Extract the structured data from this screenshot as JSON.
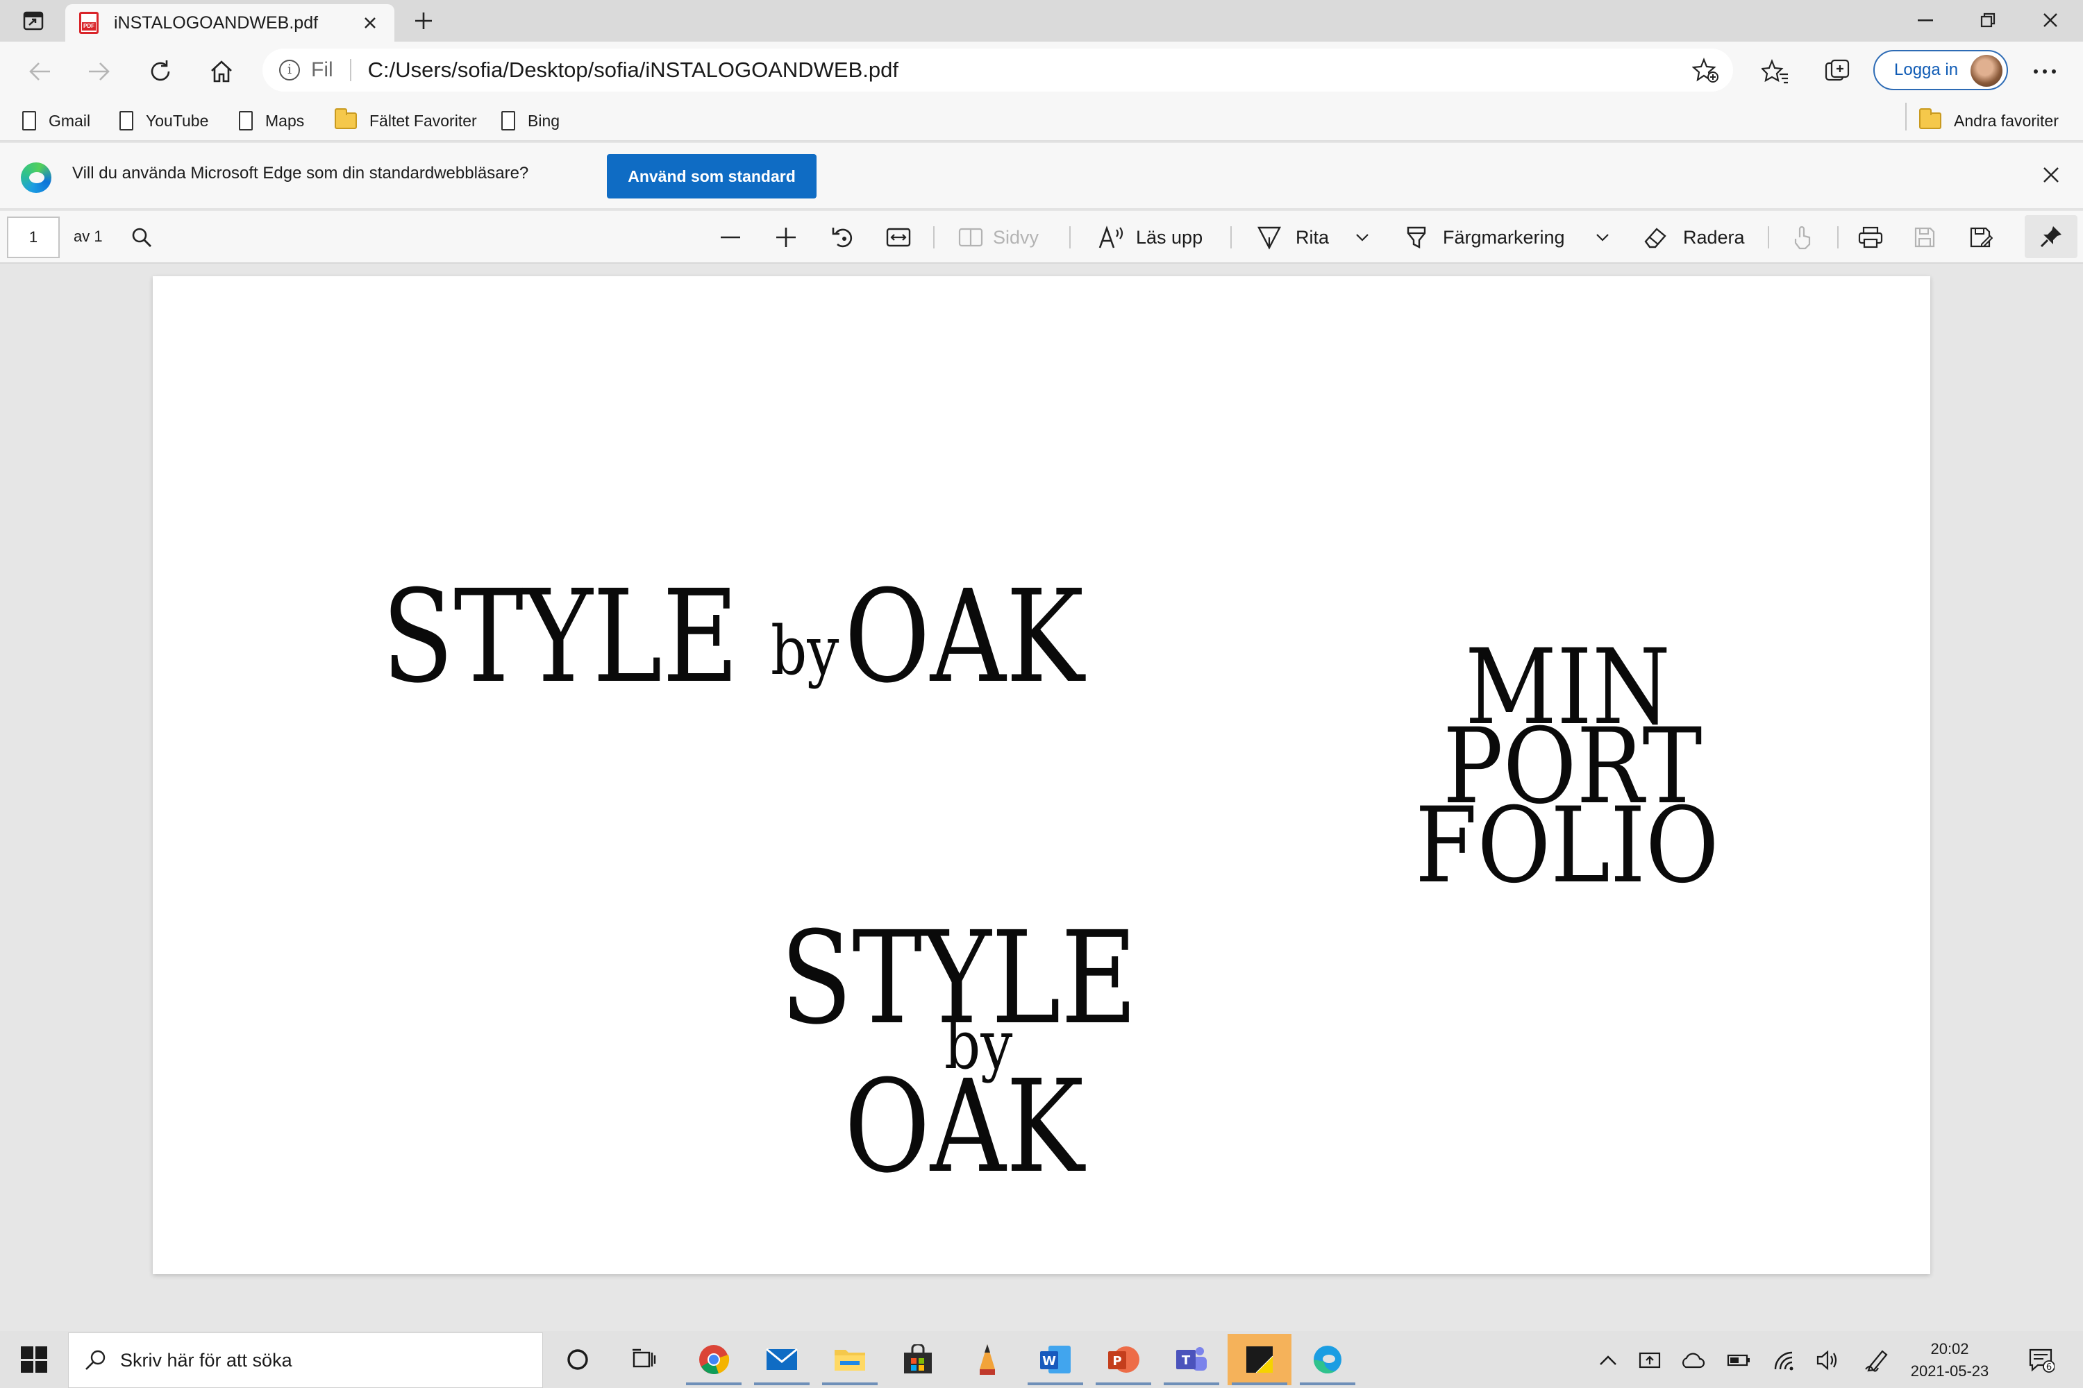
{
  "browser": {
    "tab": {
      "title": "iNSTALOGOANDWEB.pdf"
    },
    "address": {
      "protocol_label": "Fil",
      "url": "C:/Users/sofia/Desktop/sofia/iNSTALOGOANDWEB.pdf"
    },
    "login_label": "Logga in",
    "favorites": [
      {
        "label": "Gmail",
        "icon": "page-icon"
      },
      {
        "label": "YouTube",
        "icon": "page-icon"
      },
      {
        "label": "Maps",
        "icon": "page-icon"
      },
      {
        "label": "Fältet Favoriter",
        "icon": "folder-icon"
      },
      {
        "label": "Bing",
        "icon": "page-icon"
      }
    ],
    "other_favorites": "Andra favoriter",
    "infobar": {
      "message": "Vill du använda Microsoft Edge som din standardwebbläsare?",
      "button_label": "Använd som standard"
    }
  },
  "pdf_toolbar": {
    "page_number": "1",
    "page_total": "av 1",
    "page_view": "Sidvy",
    "read_aloud": "Läs upp",
    "draw": "Rita",
    "highlight": "Färgmarkering",
    "erase": "Radera"
  },
  "document": {
    "logo_horizontal": {
      "style": "STYLE",
      "by": "by",
      "oak": "OAK"
    },
    "portfolio": {
      "line1": "MIN",
      "line2": "PORT",
      "line3": "FOLIO"
    },
    "logo_stacked": {
      "style": "STYLE",
      "by": "by",
      "oak": "OAK"
    }
  },
  "taskbar": {
    "search_placeholder": "Skriv här för att söka",
    "apps": [
      "cortana-icon",
      "task-view-icon",
      "chrome-icon",
      "mail-icon",
      "file-explorer-icon",
      "store-icon",
      "pencil-app-icon",
      "word-icon",
      "powerpoint-icon",
      "teams-icon",
      "sticky-notes-icon",
      "edge-icon"
    ],
    "time": "20:02",
    "date": "2021-05-23",
    "notification_count": "6"
  },
  "colors": {
    "accent": "#0f6cc4",
    "pdf_red": "#d9252a",
    "taskbar_active": "#f5b25a"
  }
}
